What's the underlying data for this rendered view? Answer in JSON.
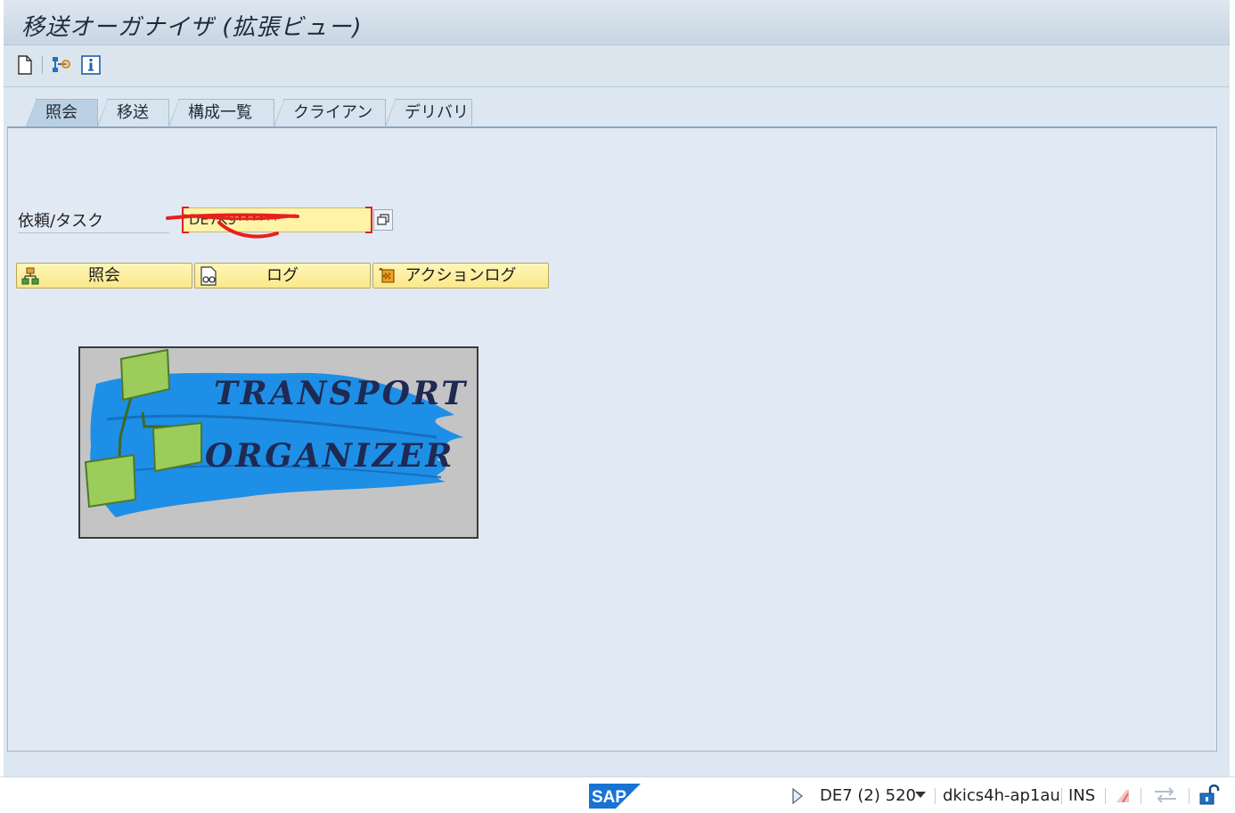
{
  "window": {
    "title": "移送オーガナイザ (拡張ビュー)"
  },
  "toolbar": {
    "icons": [
      "new-document-icon",
      "hierarchy-settings-icon",
      "info-icon"
    ]
  },
  "tabs": [
    {
      "label": "照会",
      "active": true
    },
    {
      "label": "移送",
      "active": false
    },
    {
      "label": "構成一覧",
      "active": false
    },
    {
      "label": "クライアント",
      "active": false
    },
    {
      "label": "デリバリ",
      "active": false
    }
  ],
  "form": {
    "request_label": "依頼/タスク",
    "request_value": "DE7K9******"
  },
  "buttons": {
    "display": "照会",
    "log": "ログ",
    "action_log": "アクションログ"
  },
  "logo": {
    "line1": "TRANSPORT",
    "line2": "ORGANIZER",
    "accent_color": "#1e8fe6",
    "box_color": "#9ccc5a"
  },
  "status": {
    "brand": "SAP",
    "system": "DE7 (2) 520",
    "server": "dkics4h-ap1au",
    "mode": "INS"
  }
}
